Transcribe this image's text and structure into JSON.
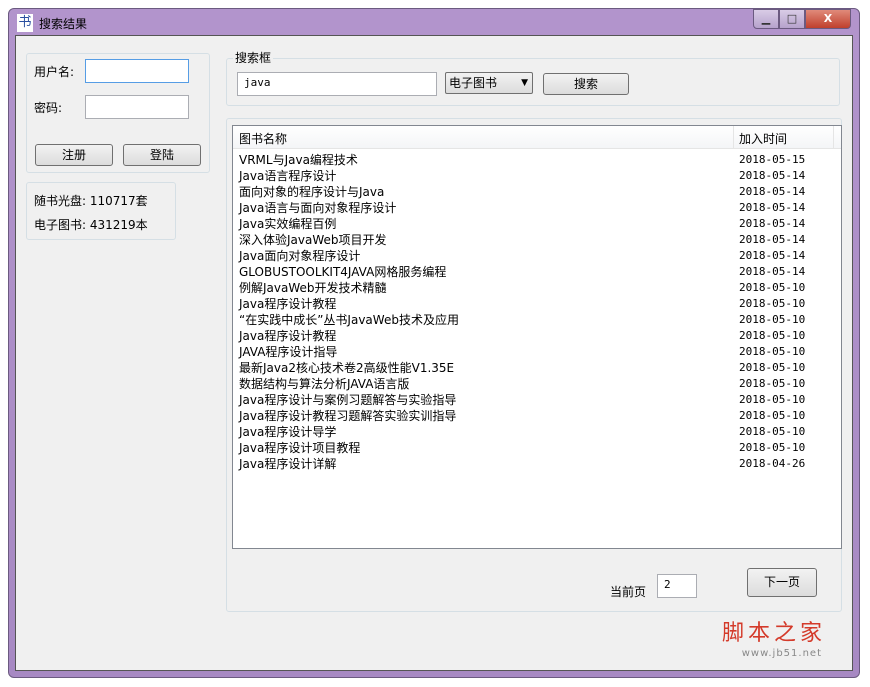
{
  "window": {
    "title": "搜索结果",
    "app_icon": "书"
  },
  "login": {
    "username_label": "用户名:",
    "password_label": "密码:",
    "username_value": "",
    "password_value": "",
    "register_label": "注册",
    "login_label": "登陆"
  },
  "stats": {
    "disc": "随书光盘: 110717套",
    "ebook": "电子图书: 431219本"
  },
  "search": {
    "group_label": "搜索框",
    "query": "java",
    "category": "电子图书",
    "button_label": "搜索"
  },
  "table": {
    "headers": [
      "图书名称",
      "加入时间"
    ],
    "rows": [
      [
        "VRML与Java编程技术",
        "2018-05-15"
      ],
      [
        "Java语言程序设计",
        "2018-05-14"
      ],
      [
        "面向对象的程序设计与Java",
        "2018-05-14"
      ],
      [
        "Java语言与面向对象程序设计",
        "2018-05-14"
      ],
      [
        "Java实效编程百例",
        "2018-05-14"
      ],
      [
        "深入体验JavaWeb项目开发",
        "2018-05-14"
      ],
      [
        "Java面向对象程序设计",
        "2018-05-14"
      ],
      [
        "GLOBUSTOOLKIT4JAVA网格服务编程",
        "2018-05-14"
      ],
      [
        "例解JavaWeb开发技术精髓",
        "2018-05-10"
      ],
      [
        "Java程序设计教程",
        "2018-05-10"
      ],
      [
        "“在实践中成长”丛书JavaWeb技术及应用",
        "2018-05-10"
      ],
      [
        "Java程序设计教程",
        "2018-05-10"
      ],
      [
        "JAVA程序设计指导",
        "2018-05-10"
      ],
      [
        "最新Java2核心技术卷2高级性能V1.35E",
        "2018-05-10"
      ],
      [
        "数据结构与算法分析JAVA语言版",
        "2018-05-10"
      ],
      [
        "Java程序设计与案例习题解答与实验指导",
        "2018-05-10"
      ],
      [
        "Java程序设计教程习题解答实验实训指导",
        "2018-05-10"
      ],
      [
        "Java程序设计导学",
        "2018-05-10"
      ],
      [
        "Java程序设计项目教程",
        "2018-05-10"
      ],
      [
        "Java程序设计详解",
        "2018-04-26"
      ]
    ]
  },
  "pager": {
    "label": "当前页",
    "page": "2",
    "next_label": "下一页"
  },
  "watermark": {
    "text": "脚本之家",
    "url": "www.jb51.net"
  }
}
